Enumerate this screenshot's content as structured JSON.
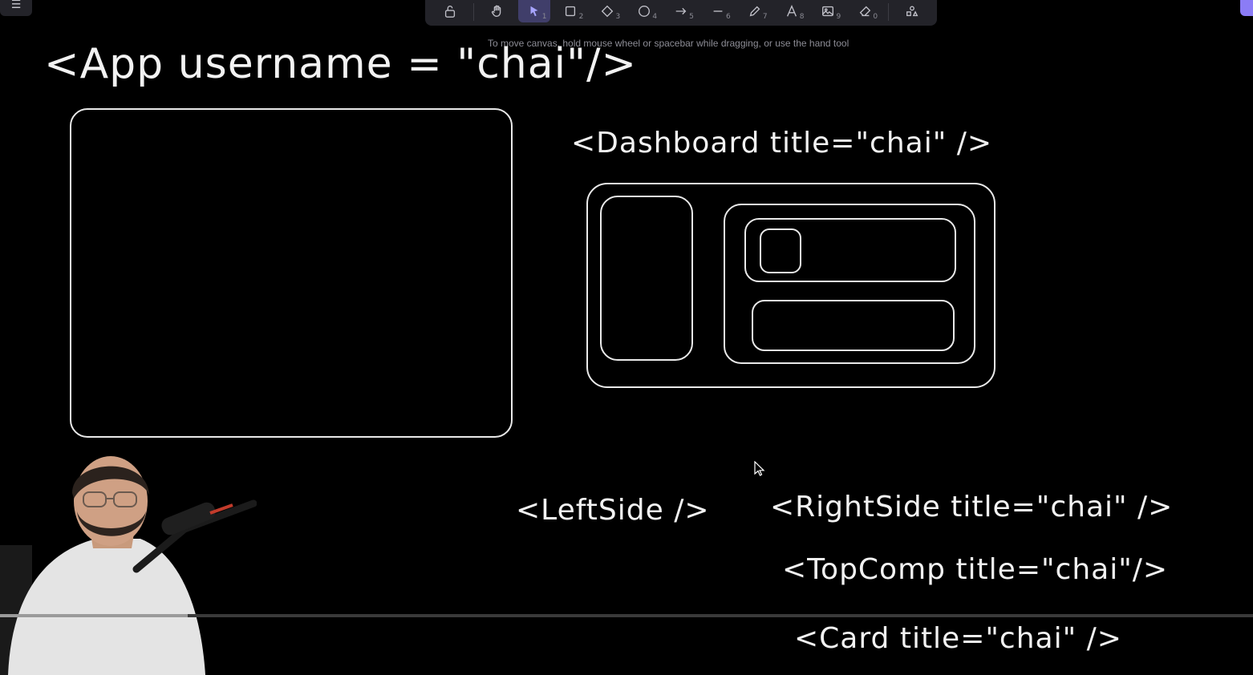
{
  "toolbar": {
    "tools": [
      {
        "name": "lock-tool",
        "icon": "lock-icon",
        "key": ""
      },
      {
        "name": "hand-tool",
        "icon": "hand-icon",
        "key": ""
      },
      {
        "name": "selection-tool",
        "icon": "pointer-icon",
        "key": "1",
        "active": true
      },
      {
        "name": "rectangle-tool",
        "icon": "rectangle-icon",
        "key": "2"
      },
      {
        "name": "diamond-tool",
        "icon": "diamond-icon",
        "key": "3"
      },
      {
        "name": "ellipse-tool",
        "icon": "circle-icon",
        "key": "4"
      },
      {
        "name": "arrow-tool",
        "icon": "arrow-right-icon",
        "key": "5"
      },
      {
        "name": "line-tool",
        "icon": "line-icon",
        "key": "6"
      },
      {
        "name": "draw-tool",
        "icon": "pencil-icon",
        "key": "7"
      },
      {
        "name": "text-tool",
        "icon": "text-icon",
        "key": "8"
      },
      {
        "name": "image-tool",
        "icon": "image-icon",
        "key": "9"
      },
      {
        "name": "eraser-tool",
        "icon": "eraser-icon",
        "key": "0"
      },
      {
        "name": "extra-tools",
        "icon": "shapes-icon",
        "key": ""
      }
    ],
    "active_color": "#403e6a"
  },
  "hint": "To move canvas, hold mouse wheel or spacebar while dragging, or use the hand tool",
  "canvas": {
    "labels": {
      "app": "<App username = \"chai\"/>",
      "dashboard": "<Dashboard title=\"chai\" />",
      "leftside": "<LeftSide />",
      "rightside": "<RightSide title=\"chai\" />",
      "topcomp": "<TopComp  title=\"chai\"/>",
      "card": "<Card title=\"chai\" />"
    }
  },
  "video": {
    "progress": 0.15
  },
  "colors": {
    "background": "#000000",
    "stroke": "#e9e9e9",
    "toolbar": "#232329",
    "accent": "#8b7cf6"
  }
}
